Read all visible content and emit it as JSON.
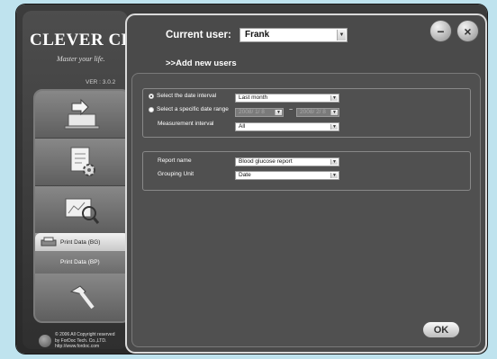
{
  "brand": {
    "logo_text": "LEVER CHEK",
    "logo_initial": "C",
    "tagline": "Master your life.",
    "version": "VER : 3.0.2"
  },
  "header": {
    "current_user_label": "Current user:",
    "current_user_value": "Frank",
    "add_users_link": ">>Add new users"
  },
  "nav": {
    "submenu": {
      "print_bg": "Print Data (BG)",
      "print_bp": "Print Data (BP)"
    }
  },
  "copyright": {
    "line1": "© 2006 All Copyright reserved",
    "line2": "by ForDoc Tech. Co.,LTD.",
    "line3": "http://www.fordoc.com"
  },
  "filters": {
    "date_interval_label": "Select the date interval",
    "date_interval_value": "Last month",
    "date_range_label": "Select a specific date range",
    "range_from": "2008/ 1/ 8",
    "range_to": "2008/ 2/ 8",
    "range_sep": "~",
    "measurement_label": "Measurement interval",
    "measurement_value": "All"
  },
  "report": {
    "report_name_label": "Report name",
    "report_name_value": "Blood glucose report",
    "grouping_label": "Grouping Unit",
    "grouping_value": "Date"
  },
  "actions": {
    "ok_label": "OK",
    "minimize_symbol": "−",
    "close_symbol": "×"
  },
  "dropdown_arrow": "▼"
}
